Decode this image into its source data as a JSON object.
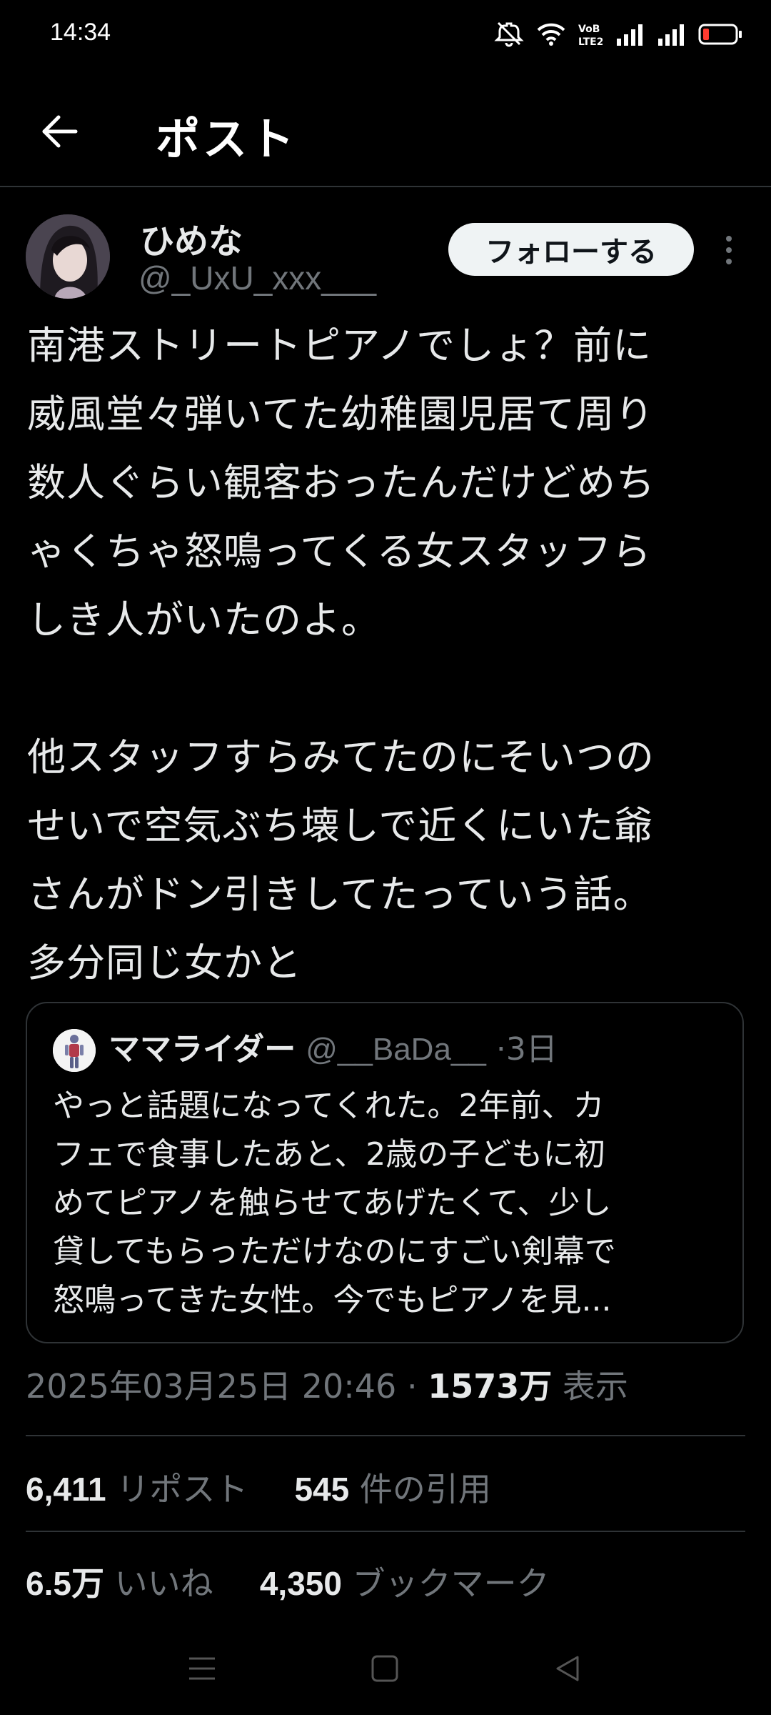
{
  "status_bar": {
    "time": "14:34",
    "icons": [
      "mute-icon",
      "wifi-icon",
      "volte-icon",
      "signal-icon",
      "signal-icon",
      "battery-icon"
    ],
    "battery_color": "#ff3b30"
  },
  "header": {
    "title": "ポスト",
    "back_icon": "arrow-left-icon"
  },
  "post": {
    "author": {
      "display_name": "ひめな",
      "handle": "@_UxU_xxx___"
    },
    "follow_label": "フォローする",
    "more_icon": "more-vertical-icon",
    "text": "南港ストリートピアノでしょ？前に\n威風堂々弾いてた幼稚園児居て周り\n数人ぐらい観客おったんだけどめち\nゃくちゃ怒鳴ってくる女スタッフら\nしき人がいたのよ。\n\n他スタッフすらみてたのにそいつの\nせいで空気ぶち壊しで近くにいた爺\nさんがドン引きしてたっていう話。\n多分同じ女かと",
    "quote": {
      "display_name": "ママライダー",
      "handle": "@__BaDa__",
      "separator": "·",
      "time": "3日",
      "text": "やっと話題になってくれた。2年前、カ\nフェで食事したあと、2歳の子どもに初\nめてピアノを触らせてあげたくて、少し\n貸してもらっただけなのにすごい剣幕で\n怒鳴ってきた女性。今でもピアノを見..."
    },
    "timestamp": "2025年03月25日 20:46",
    "dot": "·",
    "views": "1573万",
    "views_label": "表示",
    "stats": {
      "reposts": "6,411",
      "reposts_label": "リポスト",
      "quotes": "545",
      "quotes_label": "件の引用",
      "likes": "6.5万",
      "likes_label": "いいね",
      "bookmarks": "4,350",
      "bookmarks_label": "ブックマーク"
    }
  },
  "nav_bar": {
    "icons": [
      "menu-icon",
      "home-square-icon",
      "back-triangle-icon"
    ]
  },
  "colors": {
    "background": "#000000",
    "text_primary": "#e7e9ea",
    "text_secondary": "#71767b",
    "border": "#2f3336",
    "follow_bg": "#eff3f4"
  }
}
